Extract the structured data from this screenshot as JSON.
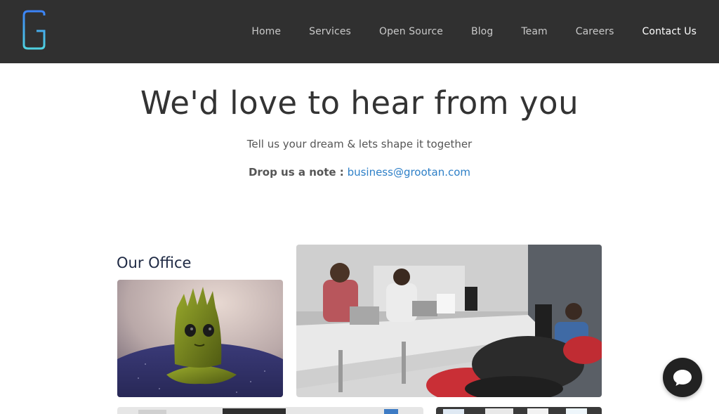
{
  "header": {
    "nav": [
      {
        "label": "Home"
      },
      {
        "label": "Services"
      },
      {
        "label": "Open Source"
      },
      {
        "label": "Blog"
      },
      {
        "label": "Team"
      },
      {
        "label": "Careers"
      },
      {
        "label": "Contact Us"
      }
    ],
    "active_item": "Contact Us",
    "logo_icon": "grootan-g-logo",
    "bg_color": "#303030"
  },
  "hero": {
    "title": "We'd love to hear from you",
    "subtitle": "Tell us your dream & lets shape it together",
    "note_label": "Drop us a note :",
    "email": "business@grootan.com"
  },
  "office": {
    "title": "Our Office"
  },
  "chat": {
    "icon": "chat-bubble-icon"
  },
  "colors": {
    "link": "#2d7fc7",
    "logo_gradient_start": "#4fd1e0",
    "logo_gradient_end": "#3b82f6"
  }
}
